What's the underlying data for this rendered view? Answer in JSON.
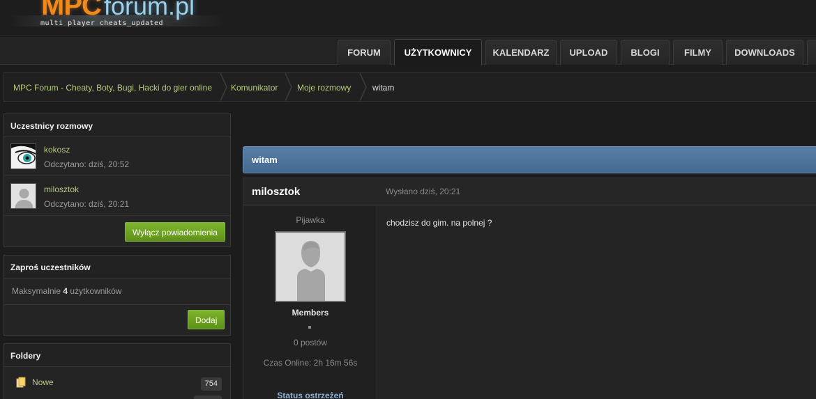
{
  "logo": {
    "mpc": "MPC",
    "forum": "forum.pl",
    "tagline": "multi player cheats_updated"
  },
  "nav": {
    "tabs": [
      {
        "label": "Forum"
      },
      {
        "label": "Użytkownicy"
      },
      {
        "label": "Kalendarz"
      },
      {
        "label": "Upload"
      },
      {
        "label": "Blogi"
      },
      {
        "label": "Filmy"
      },
      {
        "label": "Downloads"
      }
    ],
    "active": "Użytkownicy"
  },
  "breadcrumb": [
    "MPC Forum - Cheaty, Boty, Bugi, Hacki do gier online",
    "Komunikator",
    "Moje rozmowy",
    "witam"
  ],
  "participants": {
    "title": "Uczestnicy rozmowy",
    "members": [
      {
        "name": "kokosz",
        "read": "Odczytano: dziś, 20:52"
      },
      {
        "name": "milosztok",
        "read": "Odczytano: dziś, 20:21"
      }
    ],
    "notify_button": "Wyłącz powiadomienia"
  },
  "invite": {
    "title": "Zaproś uczestników",
    "prefix": "Maksymalnie",
    "max": "4",
    "suffix": "użytkowników",
    "add_button": "Dodaj"
  },
  "folders": {
    "title": "Foldery",
    "items": [
      {
        "name": "Nowe",
        "count": "754"
      }
    ]
  },
  "conversation": {
    "title": "witam",
    "post": {
      "author": "milosztok",
      "date": "Wysłano dziś, 20:21",
      "rank": "Pijawka",
      "group": "Members",
      "posts": "0 postów",
      "online_time": "Czas Online: 2h 16m 56s",
      "warn_status": "Status ostrzeżeń",
      "body": "chodzisz do gim. na polnej ?"
    }
  },
  "colors": {
    "accent_green": "#6fa423",
    "title_blue": "#4f76a0",
    "link": "#b9c98a"
  }
}
